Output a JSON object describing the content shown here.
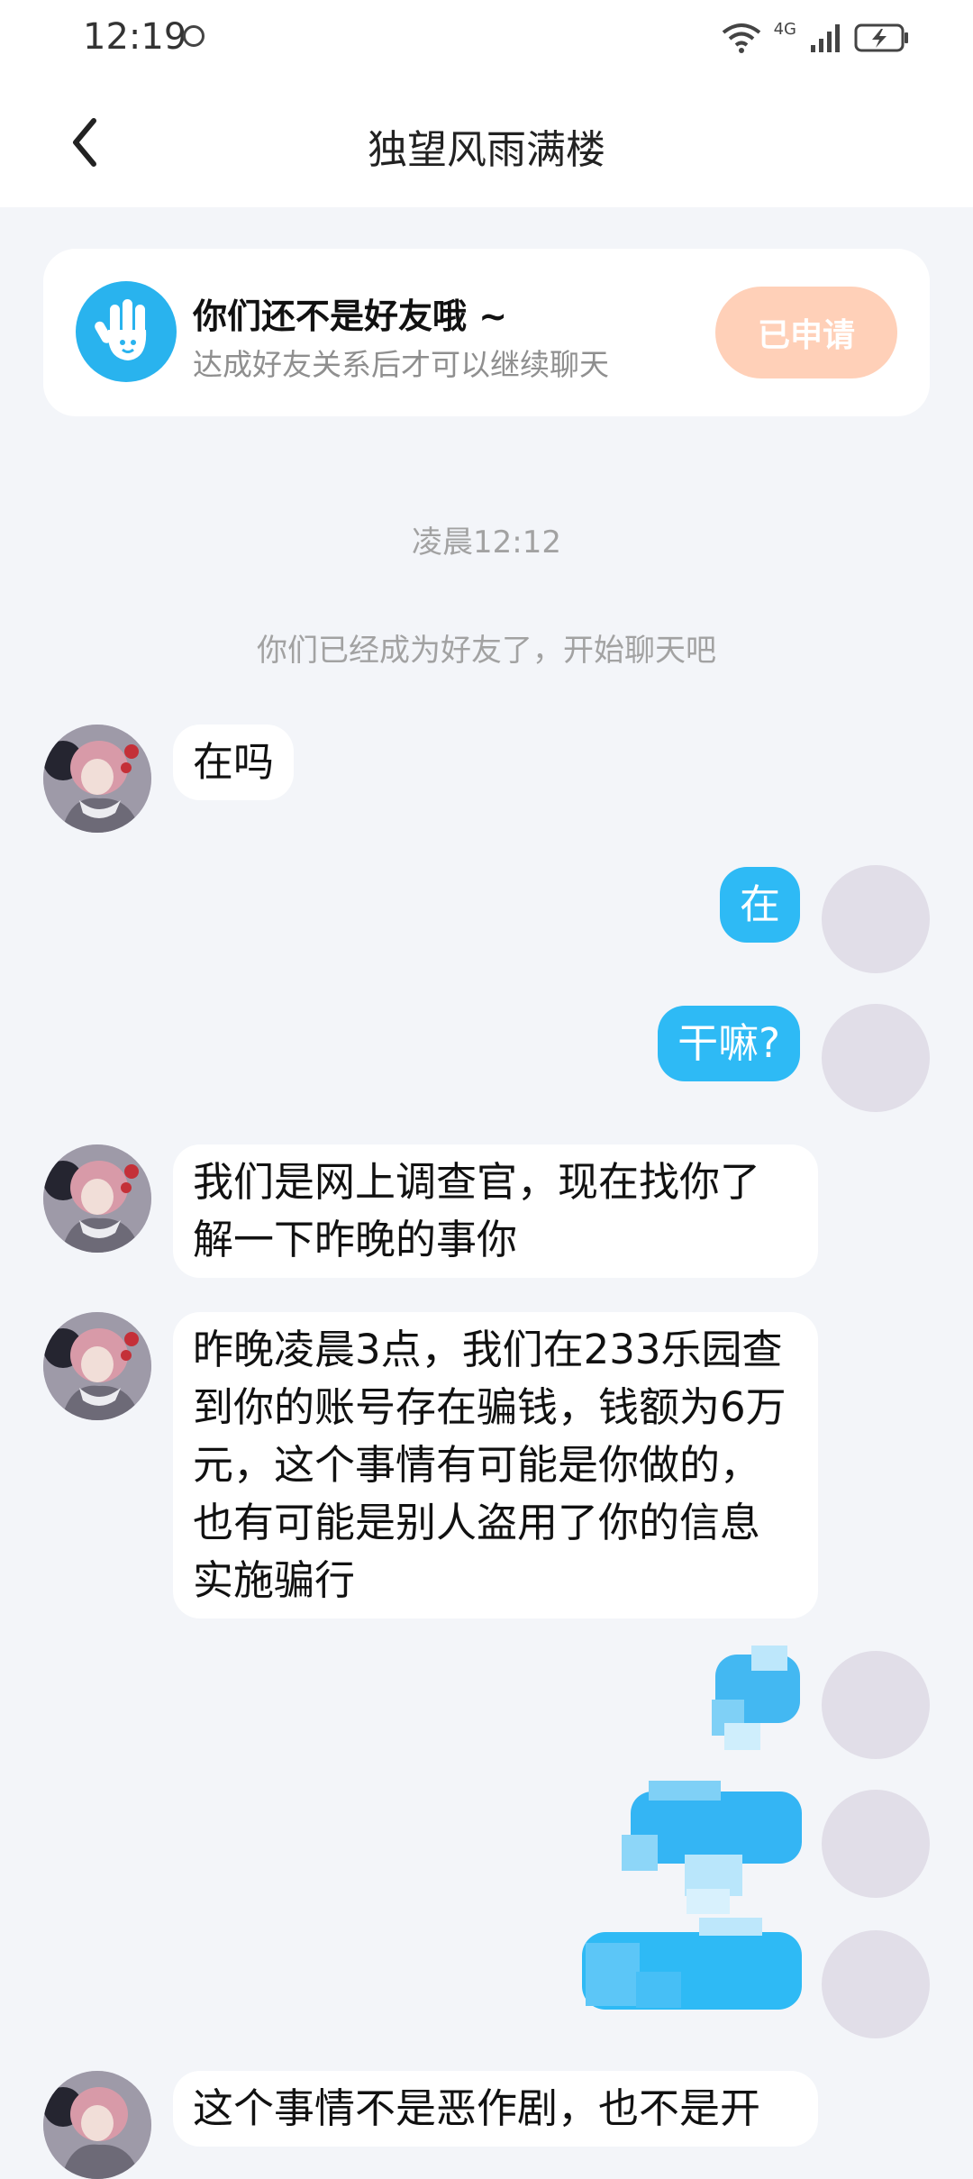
{
  "status_bar": {
    "time": "12:19",
    "network": "4G"
  },
  "header": {
    "title": "独望风雨满楼"
  },
  "friend_notice": {
    "title": "你们还不是好友哦 ~",
    "subtitle": "达成好友关系后才可以继续聊天",
    "button_label": "已申请"
  },
  "chat": {
    "timestamp": "凌晨12:12",
    "system_message": "你们已经成为好友了，开始聊天吧",
    "messages": [
      {
        "from": "other",
        "text": "在吗"
      },
      {
        "from": "self",
        "text": "在"
      },
      {
        "from": "self",
        "text": "干嘛?"
      },
      {
        "from": "other",
        "text": "我们是网上调查官，现在找你了解一下昨晚的事你"
      },
      {
        "from": "other",
        "text": "昨晚凌晨3点，我们在233乐园查到你的账号存在骗钱，钱额为6万元，这个事情有可能是你做的，也有可能是别人盗用了你的信息实施骗行"
      },
      {
        "from": "self",
        "text": ""
      },
      {
        "from": "self",
        "text": ""
      },
      {
        "from": "self",
        "text": ""
      },
      {
        "from": "other",
        "text": "这个事情不是恶作剧，也不是开"
      }
    ]
  },
  "colors": {
    "self_bubble": "#2ebaf5",
    "other_bubble": "#ffffff",
    "applied_button": "#ffd0b8",
    "background": "#f3f5f9"
  }
}
